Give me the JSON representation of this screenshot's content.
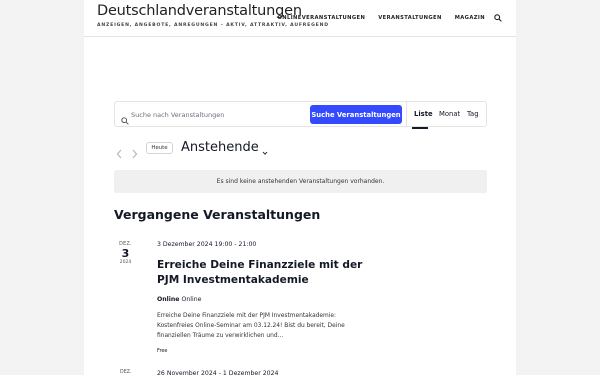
{
  "site": {
    "title": "Deutschlandveranstaltungen",
    "tagline": "ANZEIGEN, ANGEBOTE, ANREGUNGEN – AKTIV, ATTRAKTIV, AUFREGEND"
  },
  "nav": {
    "items": [
      "ONLINEVERANSTALTUNGEN",
      "VERANSTALTUNGEN",
      "MAGAZIN"
    ],
    "search_icon": "search-icon"
  },
  "search": {
    "placeholder": "Suche nach Veranstaltungen",
    "value": "",
    "button_label": "Suche Veranstaltungen",
    "views": [
      "Liste",
      "Monat",
      "Tag"
    ],
    "active_view": "Liste"
  },
  "date_nav": {
    "today_label": "Heute",
    "period_label": "Anstehende"
  },
  "notice": "Es sind keine anstehenden Veranstaltungen vorhanden.",
  "past_heading": "Vergangene Veranstaltungen",
  "events": [
    {
      "month": "DEZ.",
      "day": "3",
      "year": "2024",
      "datetime": "3 Dezember 2024 19:00 - 21:00",
      "title": "Erreiche Deine Finanzziele mit der PJM Investmentakademie",
      "venue_name": "Online",
      "venue_detail": "Online",
      "description": "Erreiche Deine Finanzziele mit der PJM Investmentakademie: Kostenfreies Online-Seminar am 03.12.24! Bist du bereit, Deine finanziellen Träume zu verwirklichen und...",
      "cost": "Free"
    }
  ],
  "next_event_partial": {
    "month": "DEZ.",
    "datetime": "26 November 2024 - 1 Dezember 2024"
  },
  "colors": {
    "accent": "#334aff",
    "text": "#141827",
    "notice_bg": "#f0f0f0",
    "side_bg": "#f3f3f3"
  }
}
